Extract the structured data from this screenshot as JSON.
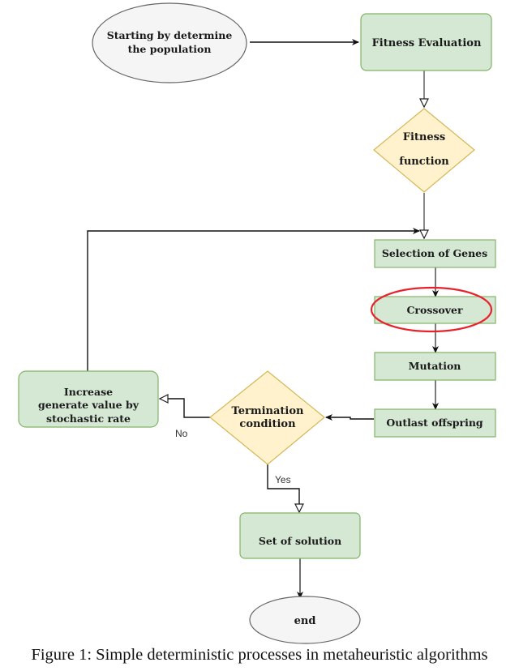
{
  "diagram": {
    "nodes": {
      "start": {
        "lines": [
          "Starting by determine",
          "the population"
        ],
        "shape": "ellipse"
      },
      "fitness_eval": {
        "lines": [
          "Fitness Evaluation"
        ],
        "shape": "rounded-rect"
      },
      "fitness_func": {
        "lines": [
          "Fitness",
          "function"
        ],
        "shape": "diamond"
      },
      "selection": {
        "lines": [
          "Selection of Genes"
        ],
        "shape": "rect"
      },
      "crossover": {
        "lines": [
          "Crossover"
        ],
        "shape": "rect",
        "highlighted": true
      },
      "mutation": {
        "lines": [
          "Mutation"
        ],
        "shape": "rect"
      },
      "outlast": {
        "lines": [
          "Outlast offspring"
        ],
        "shape": "rect"
      },
      "termination": {
        "lines": [
          "Termination",
          "condition"
        ],
        "shape": "diamond"
      },
      "increase": {
        "lines": [
          "Increase",
          "generate value by",
          "stochastic rate"
        ],
        "shape": "rounded-rect"
      },
      "solution": {
        "lines": [
          "Set of solution"
        ],
        "shape": "rounded-rect"
      },
      "end": {
        "lines": [
          "end"
        ],
        "shape": "ellipse"
      }
    },
    "edges": [
      {
        "from": "start",
        "to": "fitness_eval"
      },
      {
        "from": "fitness_eval",
        "to": "fitness_func"
      },
      {
        "from": "fitness_func",
        "to": "selection"
      },
      {
        "from": "selection",
        "to": "crossover"
      },
      {
        "from": "crossover",
        "to": "mutation"
      },
      {
        "from": "mutation",
        "to": "outlast"
      },
      {
        "from": "outlast",
        "to": "termination"
      },
      {
        "from": "termination",
        "to": "increase",
        "label": "No"
      },
      {
        "from": "termination",
        "to": "solution",
        "label": "Yes"
      },
      {
        "from": "increase",
        "to": "selection"
      },
      {
        "from": "solution",
        "to": "end"
      }
    ],
    "labels": {
      "no": "No",
      "yes": "Yes"
    },
    "colors": {
      "process_fill": "#d5e8d4",
      "process_stroke": "#82b366",
      "decision_fill": "#fff2cc",
      "decision_stroke": "#d6b656",
      "terminal_fill": "#f5f5f5",
      "terminal_stroke": "#666666",
      "highlight": "#e8222a"
    }
  },
  "caption": "Figure 1: Simple deterministic processes in metaheuristic algorithms"
}
